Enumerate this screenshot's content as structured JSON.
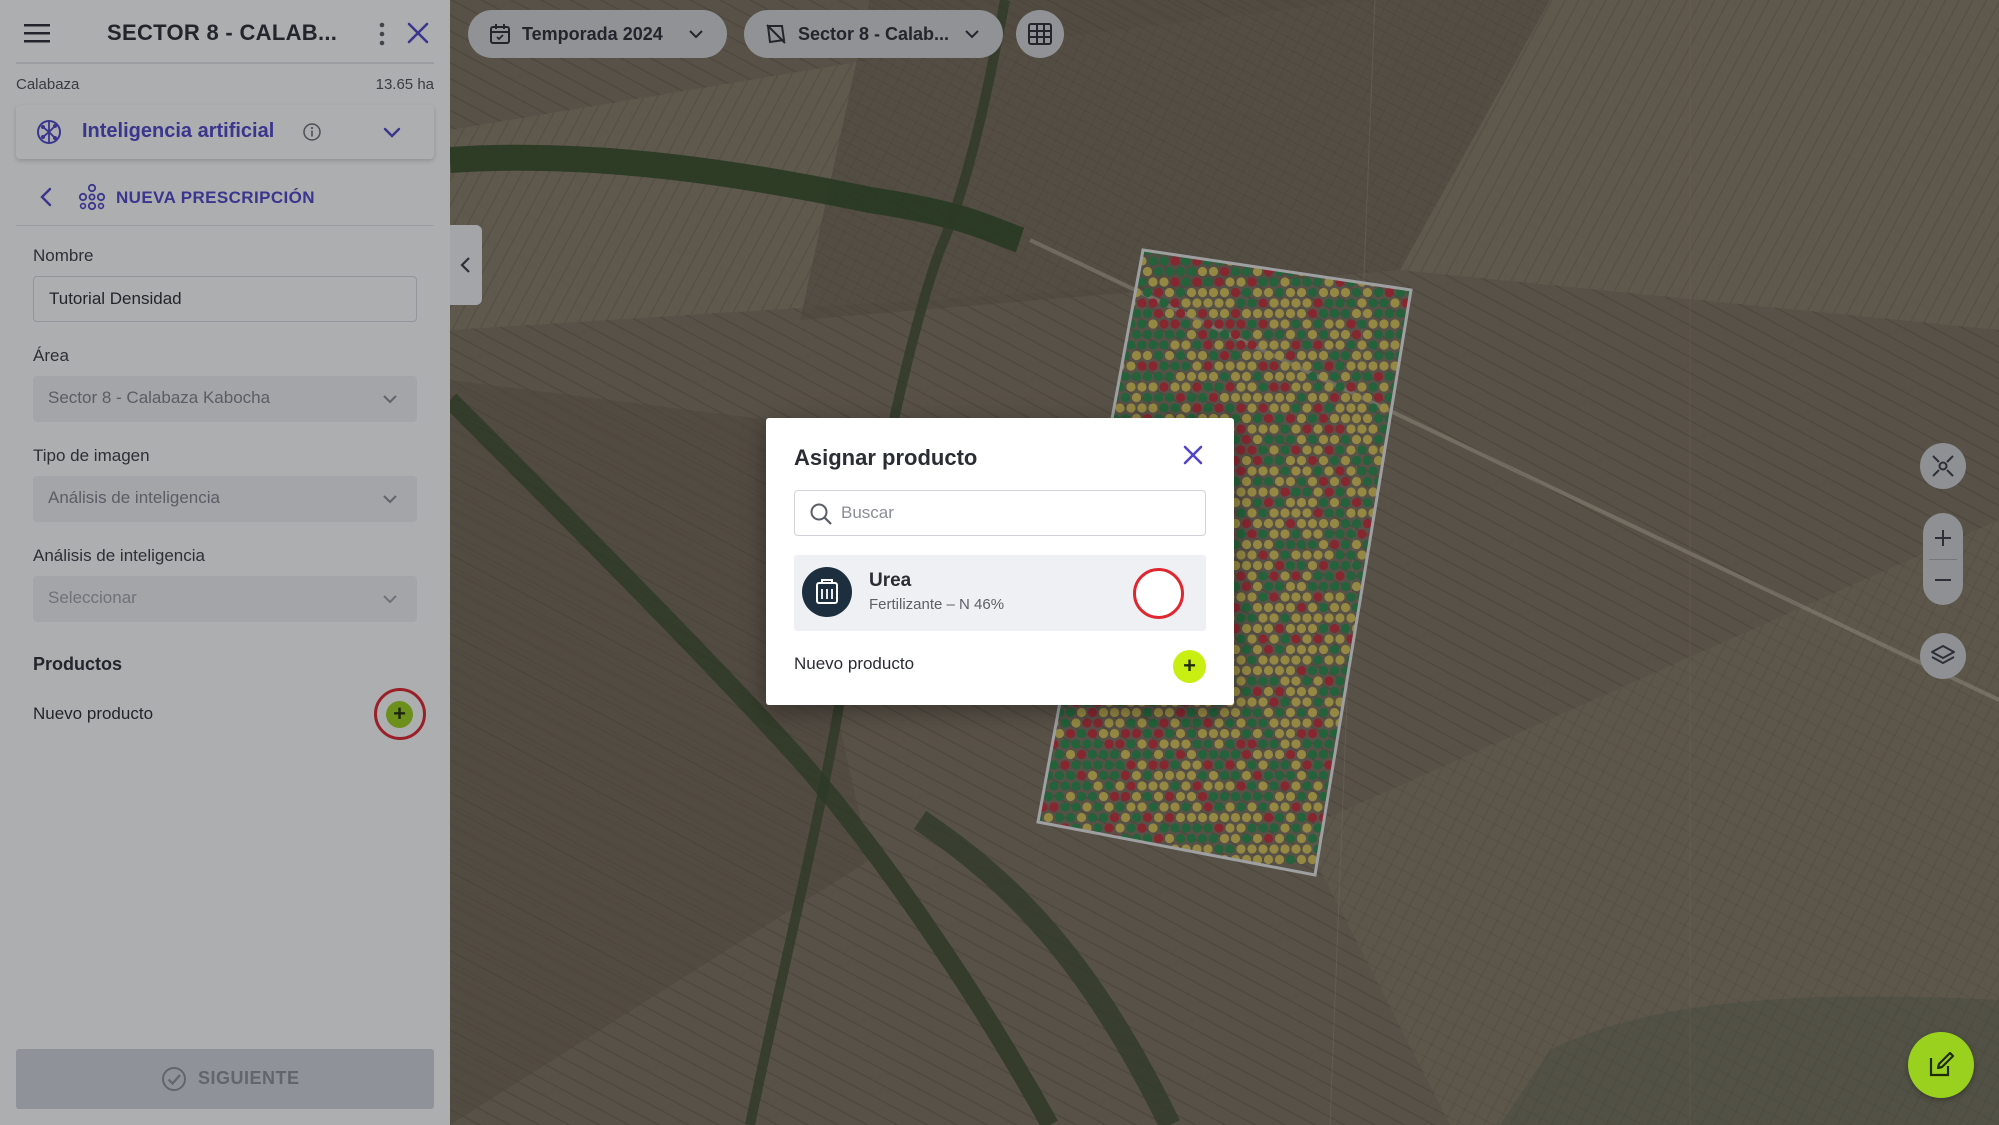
{
  "sidebar": {
    "title": "SECTOR 8 - CALAB...",
    "crop": "Calabaza",
    "area": "13.65 ha",
    "ai_section": "Inteligencia artificial",
    "new_prescription": "NUEVA PRESCRIPCIÓN",
    "fields": {
      "nombre_label": "Nombre",
      "nombre_value": "Tutorial Densidad",
      "area_label": "Área",
      "area_value": "Sector 8 - Calabaza Kabocha",
      "tipo_label": "Tipo de imagen",
      "tipo_value": "Análisis de inteligencia",
      "analisis_label": "Análisis de inteligencia",
      "analisis_placeholder": "Seleccionar"
    },
    "products_title": "Productos",
    "new_product": "Nuevo producto",
    "next_button": "SIGUIENTE"
  },
  "toolbar": {
    "season": "Temporada 2024",
    "sector": "Sector 8 - Calab..."
  },
  "modal": {
    "title": "Asignar producto",
    "search_placeholder": "Buscar",
    "product": {
      "name": "Urea",
      "description": "Fertilizante – N 46%"
    },
    "new_product": "Nuevo producto"
  },
  "colors": {
    "accent": "#4f46c9",
    "add_green": "#c8ee12",
    "highlight_red": "#e0262e",
    "zone_high": "#2c8a4a",
    "zone_mid": "#d9c557",
    "zone_low": "#c4303b"
  },
  "icons": [
    "menu-icon",
    "kebab-icon",
    "close-icon",
    "brain-icon",
    "info-icon",
    "chevron-down-icon",
    "back-icon",
    "dots-network-icon",
    "check-icon",
    "calendar-icon",
    "field-icon",
    "table-icon",
    "recenter-icon",
    "zoom-in-icon",
    "zoom-out-icon",
    "layers-icon",
    "edit-icon",
    "search-icon",
    "product-icon"
  ]
}
